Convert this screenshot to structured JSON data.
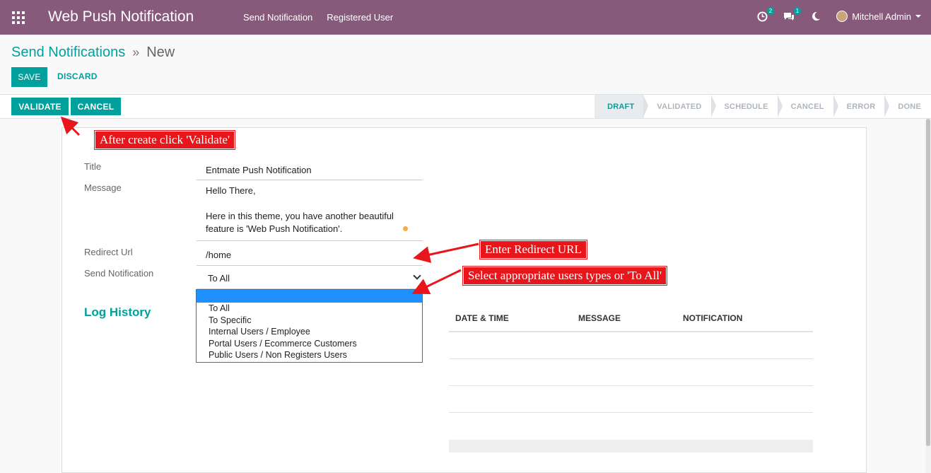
{
  "navbar": {
    "app_title": "Web Push Notification",
    "menu": [
      "Send Notification",
      "Registered User"
    ],
    "activity_badge": "2",
    "messages_badge": "1",
    "user_name": "Mitchell Admin"
  },
  "breadcrumb": {
    "parent": "Send Notifications",
    "separator": "»",
    "current": "New"
  },
  "actions": {
    "save": "SAVE",
    "discard": "DISCARD"
  },
  "statusbar": {
    "validate": "VALIDATE",
    "cancel": "CANCEL",
    "stages": [
      "DRAFT",
      "VALIDATED",
      "SCHEDULE",
      "CANCEL",
      "ERROR",
      "DONE"
    ],
    "active_stage": "DRAFT"
  },
  "form": {
    "title_label": "Title",
    "title_value": "Entmate Push Notification",
    "message_label": "Message",
    "message_line1": "Hello There,",
    "message_line2": "Here in this theme, you have another beautiful",
    "message_line3": "feature is 'Web Push Notification'.",
    "redirect_label": "Redirect Url",
    "redirect_value": "/home",
    "send_label": "Send Notification",
    "send_value": "To All",
    "send_options": [
      "",
      "To All",
      "To Specific",
      "Internal Users / Employee",
      "Portal Users / Ecommerce Customers",
      "Public Users / Non Registers Users"
    ]
  },
  "log": {
    "title": "Log History",
    "columns": [
      "DATE & TIME",
      "MESSAGE",
      "NOTIFICATION"
    ]
  },
  "annotations": {
    "validate": "After create click 'Validate'",
    "redirect": "Enter Redirect URL",
    "users": "Select appropriate users types or 'To All'"
  },
  "colors": {
    "navbar": "#875a7b",
    "primary": "#00a09d",
    "callout": "#e8151b",
    "dropdown_selected": "#1e90ff"
  }
}
